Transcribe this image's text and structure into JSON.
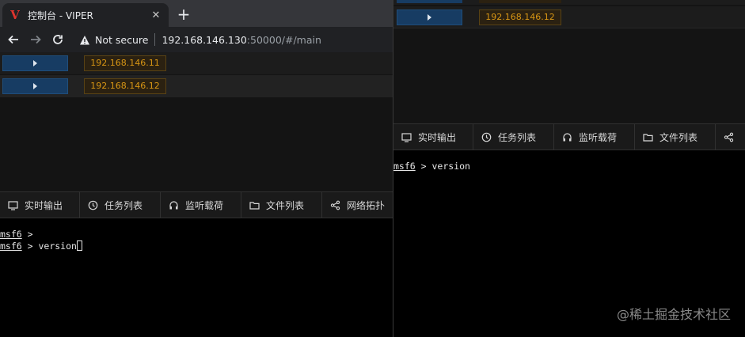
{
  "browser": {
    "tab_title": "控制台 - VIPER",
    "favicon_letter": "V",
    "close_glyph": "✕",
    "new_tab_glyph": "+",
    "not_secure": "Not secure",
    "url_host": "192.168.146.130",
    "url_rest": ":50000/#/main"
  },
  "left": {
    "hosts": [
      {
        "ip": "192.168.146.11"
      },
      {
        "ip": "192.168.146.12"
      }
    ],
    "tabs": [
      {
        "label": "实时输出",
        "icon": "monitor-icon"
      },
      {
        "label": "任务列表",
        "icon": "clock-icon"
      },
      {
        "label": "监听载荷",
        "icon": "headphones-icon"
      },
      {
        "label": "文件列表",
        "icon": "folder-icon"
      },
      {
        "label": "网络拓扑",
        "icon": "share-icon"
      }
    ],
    "terminal": {
      "lines": [
        {
          "prompt": "msf6",
          "rest": " > "
        },
        {
          "prompt": "msf6",
          "rest": " > version"
        }
      ]
    }
  },
  "right": {
    "hosts": [
      {
        "ip": "192.168.146.12"
      }
    ],
    "tabs": [
      {
        "label": "实时输出",
        "icon": "monitor-icon"
      },
      {
        "label": "任务列表",
        "icon": "clock-icon"
      },
      {
        "label": "监听载荷",
        "icon": "headphones-icon"
      },
      {
        "label": "文件列表",
        "icon": "folder-icon"
      },
      {
        "label": "",
        "icon": "share-icon"
      }
    ],
    "terminal": {
      "lines": [
        {
          "prompt": "msf6",
          "rest": " > version"
        }
      ]
    }
  },
  "watermark": "@稀土掘金技术社区",
  "colors": {
    "ip_tag_text": "#d89614",
    "expand_button": "#173c63",
    "terminal_bg": "#000000"
  }
}
